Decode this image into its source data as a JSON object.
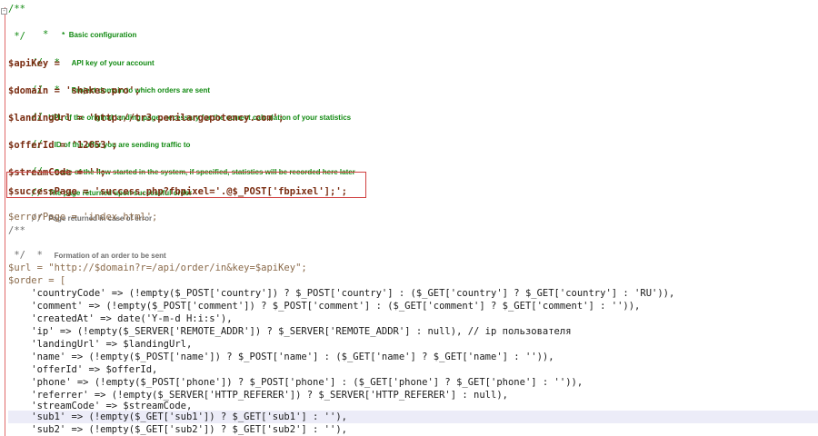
{
  "lines": [
    {
      "id": "l01",
      "text": "/**",
      "cls": "green"
    },
    {
      "id": "l02",
      "text": " *  Basic configuration",
      "cls": "green ann"
    },
    {
      "id": "l03",
      "text": " */",
      "cls": "green"
    },
    {
      "id": "l04a",
      "text": "//  *  ",
      "cls": "green"
    },
    {
      "id": "l04b",
      "text": "API key of your account",
      "cls": "green ann"
    },
    {
      "id": "l05",
      "text": "$apiKey =",
      "cls": "var"
    },
    {
      "id": "l06a",
      "text": "//  *  ",
      "cls": "green"
    },
    {
      "id": "l06b",
      "text": "Project domain to which orders are sent",
      "cls": "green ann"
    },
    {
      "id": "l07",
      "text": "$domain = 'shakes.pro';"
    },
    {
      "id": "l08a",
      "text": "// ",
      "cls": "green"
    },
    {
      "id": "l08b",
      "text": "UPL of the original landing page, necessary for the correct calculation of your statistics",
      "cls": "green ann"
    },
    {
      "id": "l09",
      "text": "$landingUrl = 'http://tr3.penilargepotency.com';"
    },
    {
      "id": "l10a",
      "text": "//  ",
      "cls": "green"
    },
    {
      "id": "l10b",
      "text": "ID of the offer you are sending traffic to",
      "cls": "green ann"
    },
    {
      "id": "l11",
      "text": "$offerId = '12653';"
    },
    {
      "id": "l12a",
      "text": "//  ",
      "cls": "green"
    },
    {
      "id": "l12b",
      "text": "Code of the flow started in the system, if specified, statistics will be recorded here later",
      "cls": "green ann"
    },
    {
      "id": "l13",
      "text": "$streamCode = '';"
    },
    {
      "id": "l14a",
      "text": "// ",
      "cls": "green"
    },
    {
      "id": "l14b",
      "text": "The page returned upon successful order",
      "cls": "green ann"
    },
    {
      "id": "l15",
      "text": "$successPage = 'success.php?fbpixel='.@$_POST['fbpixel'];';"
    },
    {
      "id": "l16a",
      "text": "// ",
      "cls": "muted"
    },
    {
      "id": "l16b",
      "text": "Page returned in case of error",
      "cls": "muted ann"
    },
    {
      "id": "l17",
      "text": "$errorPage = 'index.html';"
    },
    {
      "id": "l18",
      "text": "/**",
      "cls": "muted"
    },
    {
      "id": "l19a",
      "text": " *  ",
      "cls": "muted"
    },
    {
      "id": "l19b",
      "text": "Formation of an order to be sent",
      "cls": "muted ann"
    },
    {
      "id": "l20",
      "text": " */",
      "cls": "muted"
    },
    {
      "id": "l21",
      "text": "$url = \"http://$domain?r=/api/order/in&key=$apiKey\";"
    },
    {
      "id": "l22",
      "text": "$order = ["
    },
    {
      "id": "l23",
      "text": "    'countryCode' => (!empty($_POST['country']) ? $_POST['country'] : ($_GET['country'] ? $_GET['country'] : 'RU')),"
    },
    {
      "id": "l24",
      "text": "    'comment' => (!empty($_POST['comment']) ? $_POST['comment'] : ($_GET['comment'] ? $_GET['comment'] : '')),"
    },
    {
      "id": "l25",
      "text": "    'createdAt' => date('Y-m-d H:i:s'),"
    },
    {
      "id": "l26",
      "text": "    'ip' => (!empty($_SERVER['REMOTE_ADDR']) ? $_SERVER['REMOTE_ADDR'] : null), // ip пользователя"
    },
    {
      "id": "l27",
      "text": "    'landingUrl' => $landingUrl,"
    },
    {
      "id": "l28",
      "text": "    'name' => (!empty($_POST['name']) ? $_POST['name'] : ($_GET['name'] ? $_GET['name'] : '')),"
    },
    {
      "id": "l29",
      "text": "    'offerId' => $offerId,"
    },
    {
      "id": "l30",
      "text": "    'phone' => (!empty($_POST['phone']) ? $_POST['phone'] : ($_GET['phone'] ? $_GET['phone'] : '')),"
    },
    {
      "id": "l31",
      "text": "    'referrer' => (!empty($_SERVER['HTTP_REFERER']) ? $_SERVER['HTTP_REFERER'] : null),"
    },
    {
      "id": "l32",
      "text": "    'streamCode' => $streamCode,"
    },
    {
      "id": "l33",
      "text": "    'sub1' => (!empty($_GET['sub1']) ? $_GET['sub1'] : ''),"
    },
    {
      "id": "l34",
      "text": "    'sub2' => (!empty($_GET['sub2']) ? $_GET['sub2'] : ''),"
    }
  ],
  "fold_icon_glyph": "-",
  "colors": {
    "comment_green": "#128a12",
    "variable_brown": "#7a2d12",
    "highlight_row": "#ececf8",
    "annotation_box": "#d04040"
  }
}
